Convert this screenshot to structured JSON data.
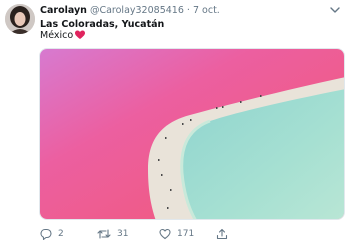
{
  "tweet": {
    "author_name": "Carolayn",
    "author_handle": "@Carolay32085416",
    "separator": "·",
    "timestamp": "7 oct.",
    "text_line1": "Las Coloradas, Yucatán",
    "text_line2": "México",
    "emoji": "red-heart"
  },
  "actions": {
    "replies": "2",
    "retweets": "31",
    "likes": "171"
  },
  "icons": {
    "avatar": "avatar",
    "menu": "chevron-down-icon",
    "reply": "reply-icon",
    "retweet": "retweet-icon",
    "like": "heart-icon",
    "share": "share-icon"
  },
  "colors": {
    "text": "#14171a",
    "secondary": "#657786",
    "heart": "#e0245e",
    "pink_lake": "#ef5a8a",
    "turquoise_water": "#9fdcd0"
  }
}
